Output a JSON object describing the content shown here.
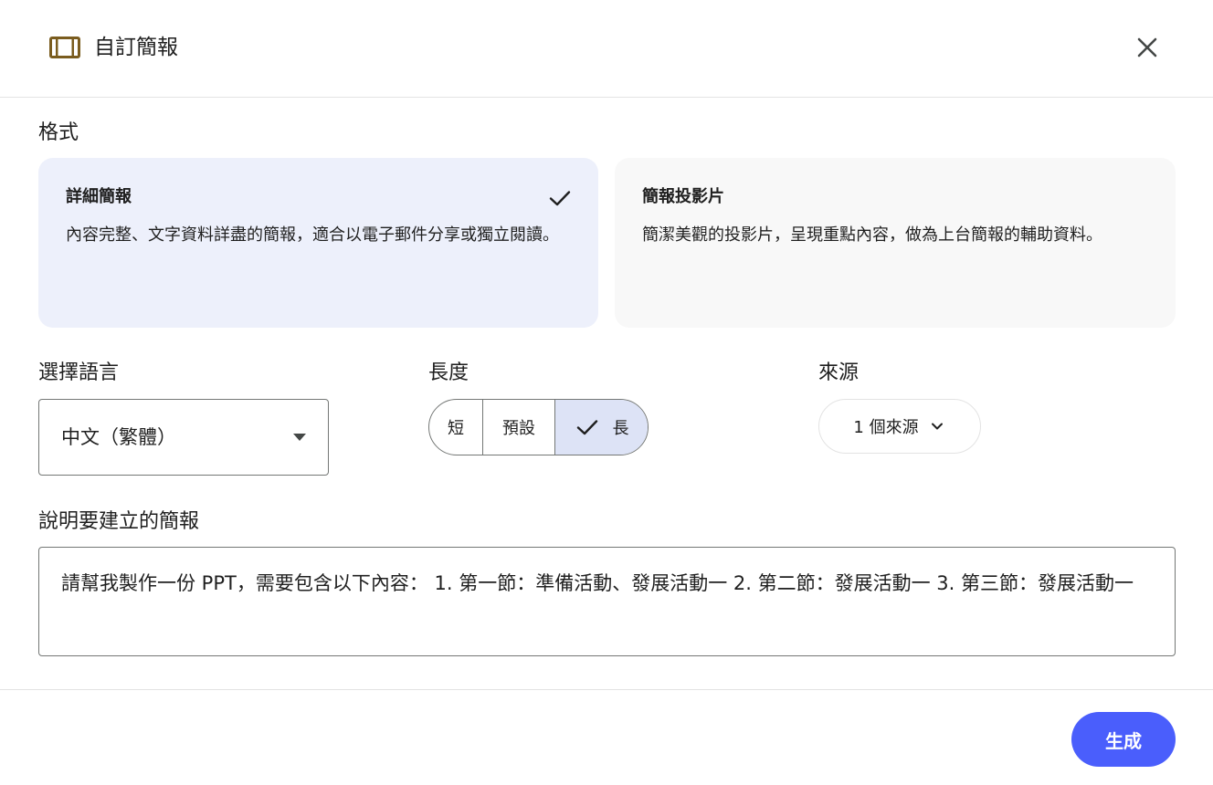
{
  "header": {
    "title": "自訂簡報",
    "icon": "slides-frame-icon",
    "close_icon": "close-icon"
  },
  "format": {
    "label": "格式",
    "cards": [
      {
        "title": "詳細簡報",
        "description": "內容完整、文字資料詳盡的簡報，適合以電子郵件分享或獨立閱讀。",
        "selected": true
      },
      {
        "title": "簡報投影片",
        "description": "簡潔美觀的投影片，呈現重點內容，做為上台簡報的輔助資料。",
        "selected": false
      }
    ]
  },
  "language": {
    "label": "選擇語言",
    "selected": "中文（繁體）"
  },
  "length": {
    "label": "長度",
    "options": [
      "短",
      "預設",
      "長"
    ],
    "selected": "長"
  },
  "source": {
    "label": "來源",
    "button_label": "1 個來源"
  },
  "description": {
    "label": "說明要建立的簡報",
    "value": "請幫我製作一份 PPT，需要包含以下內容： 1. 第一節：準備活動、發展活動一 2. 第二節：發展活動一 3. 第三節：發展活動一"
  },
  "footer": {
    "generate_label": "生成"
  },
  "colors": {
    "accent": "#4a5efc",
    "selected_card": "#edf0fb",
    "selected_segment": "#dde3f6",
    "icon_brown": "#7a5c1e"
  }
}
